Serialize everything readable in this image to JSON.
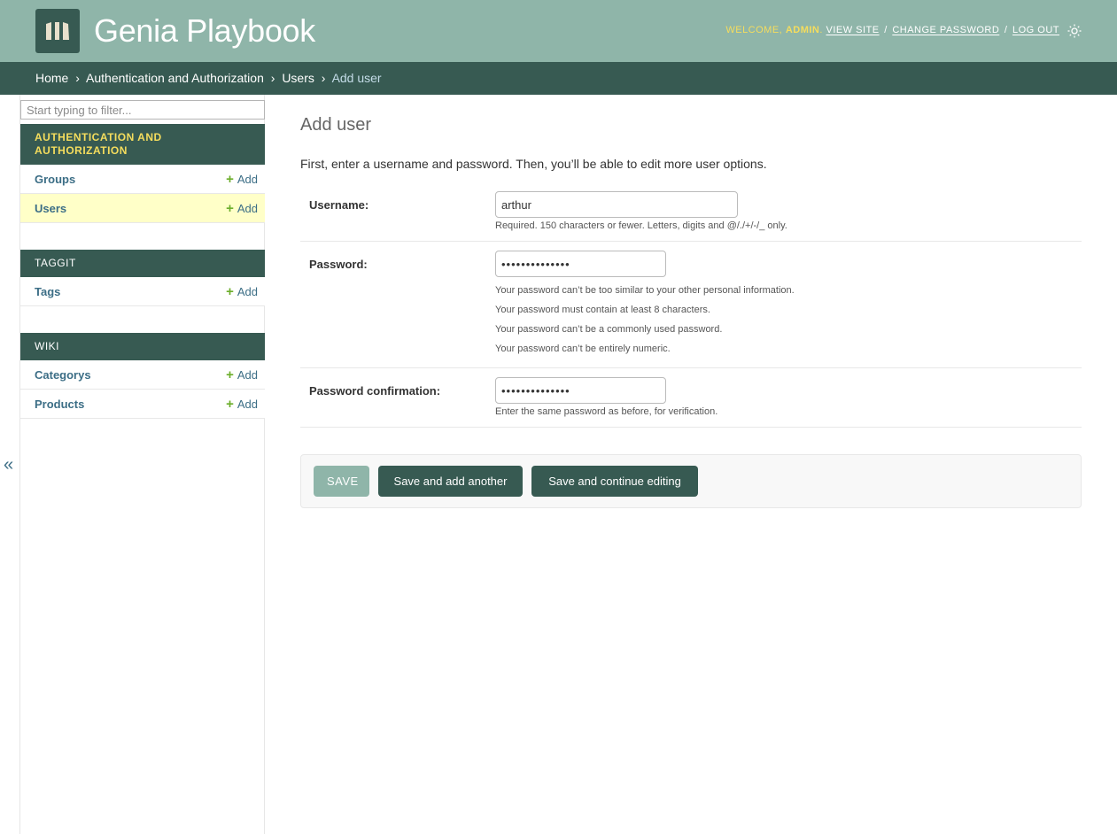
{
  "header": {
    "brand": "Genia Playbook",
    "welcome_text": "WELCOME,",
    "username": "ADMIN",
    "view_site": "VIEW SITE",
    "change_password": "CHANGE PASSWORD",
    "log_out": "LOG OUT",
    "separator": "/",
    "theme_icon": "sun-icon"
  },
  "breadcrumbs": {
    "items": [
      "Home",
      "Authentication and Authorization",
      "Users"
    ],
    "arrow": "›",
    "current": "Add user"
  },
  "sidebar": {
    "filter_placeholder": "Start typing to filter...",
    "add_label": "Add",
    "plus": "+",
    "collapse_symbol": "«",
    "modules": [
      {
        "caption": "Authentication and Authorization",
        "active": true,
        "models": [
          {
            "name": "Groups",
            "selected": false
          },
          {
            "name": "Users",
            "selected": true
          }
        ]
      },
      {
        "caption": "Taggit",
        "active": false,
        "models": [
          {
            "name": "Tags",
            "selected": false
          }
        ]
      },
      {
        "caption": "Wiki",
        "active": false,
        "models": [
          {
            "name": "Categorys",
            "selected": false
          },
          {
            "name": "Products",
            "selected": false
          }
        ]
      }
    ]
  },
  "content": {
    "title": "Add user",
    "intro": "First, enter a username and password. Then, you’ll be able to edit more user options.",
    "fields": {
      "username": {
        "label": "Username:",
        "value": "arthur",
        "help": "Required. 150 characters or fewer. Letters, digits and @/./+/-/_ only."
      },
      "password": {
        "label": "Password:",
        "value": "••••••••••••••",
        "help": [
          "Your password can’t be too similar to your other personal information.",
          "Your password must contain at least 8 characters.",
          "Your password can’t be a commonly used password.",
          "Your password can’t be entirely numeric."
        ]
      },
      "password_confirmation": {
        "label": "Password confirmation:",
        "value": "••••••••••••••",
        "help": "Enter the same password as before, for verification."
      }
    },
    "buttons": {
      "save": "SAVE",
      "save_add_another": "Save and add another",
      "save_continue": "Save and continue editing"
    }
  },
  "colors": {
    "header_bg": "#8fb5a9",
    "breadcrumb_bg": "#375a52",
    "accent_yellow": "#f5dd5d",
    "link_blue": "#3c6e86",
    "add_green": "#6cae2b",
    "selected_row": "#ffffc8"
  }
}
